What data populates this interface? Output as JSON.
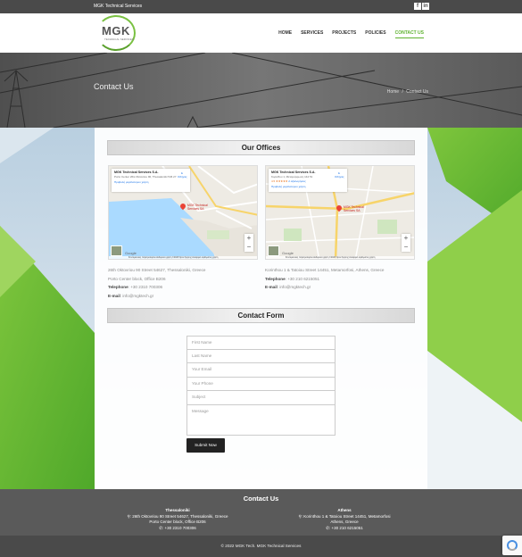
{
  "topbar": {
    "company": "MGK Technical Services",
    "social": [
      "facebook-icon",
      "linkedin-icon"
    ]
  },
  "logo": {
    "mark": "MGK",
    "tagline": "TECHNICAL SERVICES"
  },
  "nav": {
    "items": [
      {
        "label": "HOME",
        "active": false
      },
      {
        "label": "SERVICES",
        "active": false
      },
      {
        "label": "PROJECTS",
        "active": false
      },
      {
        "label": "POLICIES",
        "active": false
      },
      {
        "label": "CONTACT US",
        "active": true
      }
    ]
  },
  "hero": {
    "title": "Contact Us",
    "breadcrumb_home": "Home",
    "breadcrumb_sep": "/",
    "breadcrumb_current": "Contact Us"
  },
  "offices": {
    "heading": "Our Offices",
    "thessaloniki": {
      "map": {
        "name": "MGK Technical Services S.A.",
        "address": "Porto Center 26is Oktovriou 90, Thessaloniki 546 27",
        "link": "Προβολή μεγαλύτερου χάρτη",
        "directions": "Οδηγίες",
        "pin_label": "MGK Technical Services SA",
        "footer": "Συντομεύσεις πληκτρολογίου  Δεδομένα χάρτη ©2023  Όροι Χρήσης  Αναφορά σφάλματος χάρτη"
      },
      "address_line1": "26th Oktovriou 90 Street 54627, Thessaloniki, Greece",
      "address_line2": "Porto Center block, Office B206",
      "phone_label": "Telephone",
      "phone": ": +30 2310 700306",
      "email_label": "E-mail",
      "email": ": info@mgktech.gr"
    },
    "athens": {
      "map": {
        "name": "MGK Technical Services S.A.",
        "address": "Κορίνθου 1, Μεταμόρφωση 144 51",
        "rating": "4.5 ★★★★★",
        "reviews": "2 αξιολογήσεις",
        "link": "Προβολή μεγαλύτερου χάρτη",
        "directions": "Οδηγίες",
        "pin_label": "MGK Technical Services SA",
        "footer": "Συντομεύσεις πληκτρολογίου  Δεδομένα χάρτη ©2023  Όροι Χρήσης  Αναφορά σφάλματος χάρτη"
      },
      "address_line1": "Korinthou 1 & Tatoiou Street 14451, Metamorfosi, Athens, Greece",
      "phone_label": "Telephone",
      "phone": ": +30 210 6215051",
      "email_label": "E-mail",
      "email": ": info@mgktech.gr"
    }
  },
  "contact_form": {
    "heading": "Contact Form",
    "first_name": "First Name",
    "last_name": "Last Name",
    "email": "Your Email",
    "phone": "Your Phone",
    "subject": "Subject",
    "message": "Message",
    "submit": "Submit Now"
  },
  "footer": {
    "heading": "Contact Us",
    "thessaloniki": {
      "city": "Thessaloniki",
      "line1": ": 26th Oktovriou 90 Street 54627, Thessaloniki, Greece",
      "line2": "Porto Center block, Office B206",
      "phone": ": +30 2310 700306"
    },
    "athens": {
      "city": "Athens",
      "line1": ": Korinthou 1 & Tatoiou Street 14451, Metamorfosi",
      "line2": "Athens, Greece",
      "phone": ": +30 210 6215051"
    },
    "copyright": "© 2022 MGK Tech. MGK Technical Services"
  },
  "colors": {
    "accent": "#5fb230",
    "dark": "#4a4a4a",
    "footer": "#5a5a5a"
  }
}
